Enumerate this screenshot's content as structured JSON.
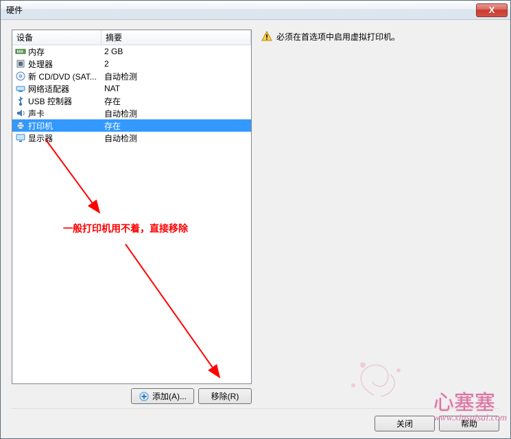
{
  "titlebar": {
    "title": "硬件",
    "close_glyph": "X"
  },
  "headers": {
    "device": "设备",
    "summary": "摘要"
  },
  "devices": [
    {
      "icon": "memory-icon",
      "name": "内存",
      "summary": "2 GB",
      "selected": false
    },
    {
      "icon": "cpu-icon",
      "name": "处理器",
      "summary": "2",
      "selected": false
    },
    {
      "icon": "cdrom-icon",
      "name": "新 CD/DVD (SAT...",
      "summary": "自动检测",
      "selected": false
    },
    {
      "icon": "network-icon",
      "name": "网络适配器",
      "summary": "NAT",
      "selected": false
    },
    {
      "icon": "usb-icon",
      "name": "USB 控制器",
      "summary": "存在",
      "selected": false
    },
    {
      "icon": "sound-icon",
      "name": "声卡",
      "summary": "自动检测",
      "selected": false
    },
    {
      "icon": "printer-icon",
      "name": "打印机",
      "summary": "存在",
      "selected": true
    },
    {
      "icon": "display-icon",
      "name": "显示器",
      "summary": "自动检测",
      "selected": false
    }
  ],
  "buttons": {
    "add": "添加(A)...",
    "remove": "移除(R)",
    "close": "关闭",
    "help": "帮助"
  },
  "warning": {
    "text": "必须在首选项中启用虚拟打印机。"
  },
  "annotation": {
    "text": "一般打印机用不着，直接移除",
    "color": "#ff0000"
  },
  "watermark": {
    "main": "心塞塞",
    "url": "www.xinsaisai.com"
  }
}
